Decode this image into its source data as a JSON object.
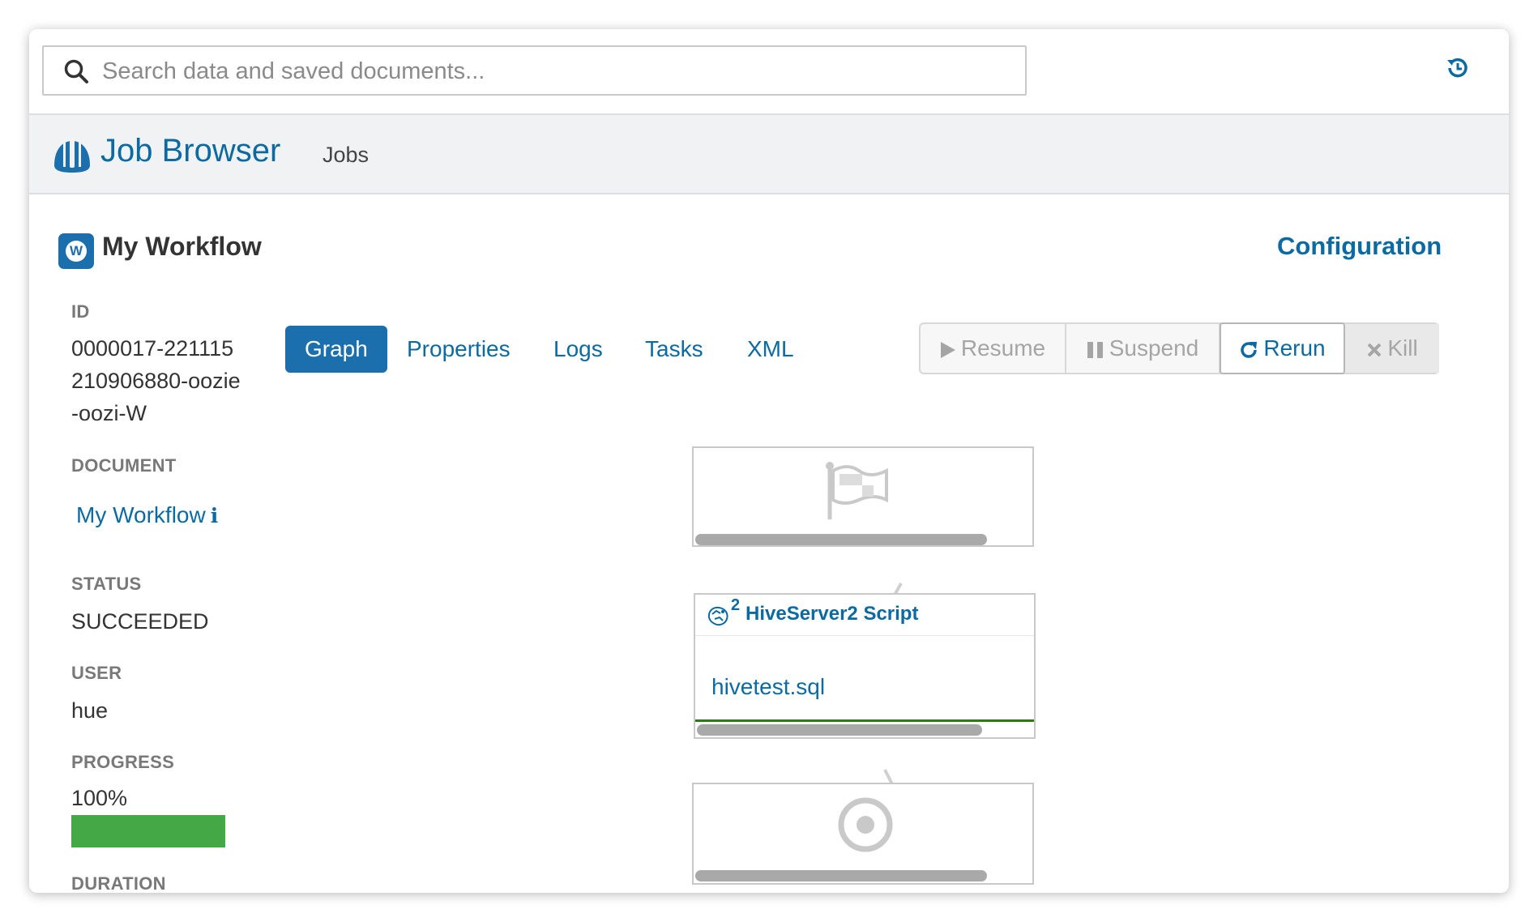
{
  "search": {
    "placeholder": "Search data and saved documents..."
  },
  "header": {
    "app_title": "Job Browser",
    "nav_jobs": "Jobs"
  },
  "workflow": {
    "badge_letter": "W",
    "title": "My Workflow",
    "configuration_link": "Configuration"
  },
  "details": {
    "id_label": "ID",
    "id_value": "0000017-221115210906880-oozie-oozi-W",
    "document_label": "DOCUMENT",
    "document_link": "My Workflow",
    "status_label": "STATUS",
    "status_value": "SUCCEEDED",
    "user_label": "USER",
    "user_value": "hue",
    "progress_label": "PROGRESS",
    "progress_value": "100%",
    "progress_fraction": 1.0,
    "duration_label": "DURATION"
  },
  "tabs": [
    {
      "label": "Graph",
      "active": true
    },
    {
      "label": "Properties",
      "active": false
    },
    {
      "label": "Logs",
      "active": false
    },
    {
      "label": "Tasks",
      "active": false
    },
    {
      "label": "XML",
      "active": false
    }
  ],
  "actions": {
    "resume": "Resume",
    "suspend": "Suspend",
    "rerun": "Rerun",
    "kill": "Kill"
  },
  "graph": {
    "start_icon": "flag-icon",
    "action": {
      "count": "2",
      "name": "HiveServer2 Script",
      "file": "hivetest.sql",
      "icon": "hive-icon"
    },
    "end_icon": "target-icon"
  },
  "colors": {
    "accent": "#0b6aa2",
    "active_tab": "#1c6fad",
    "progress": "#43a845",
    "success_line": "#2d7a12"
  }
}
